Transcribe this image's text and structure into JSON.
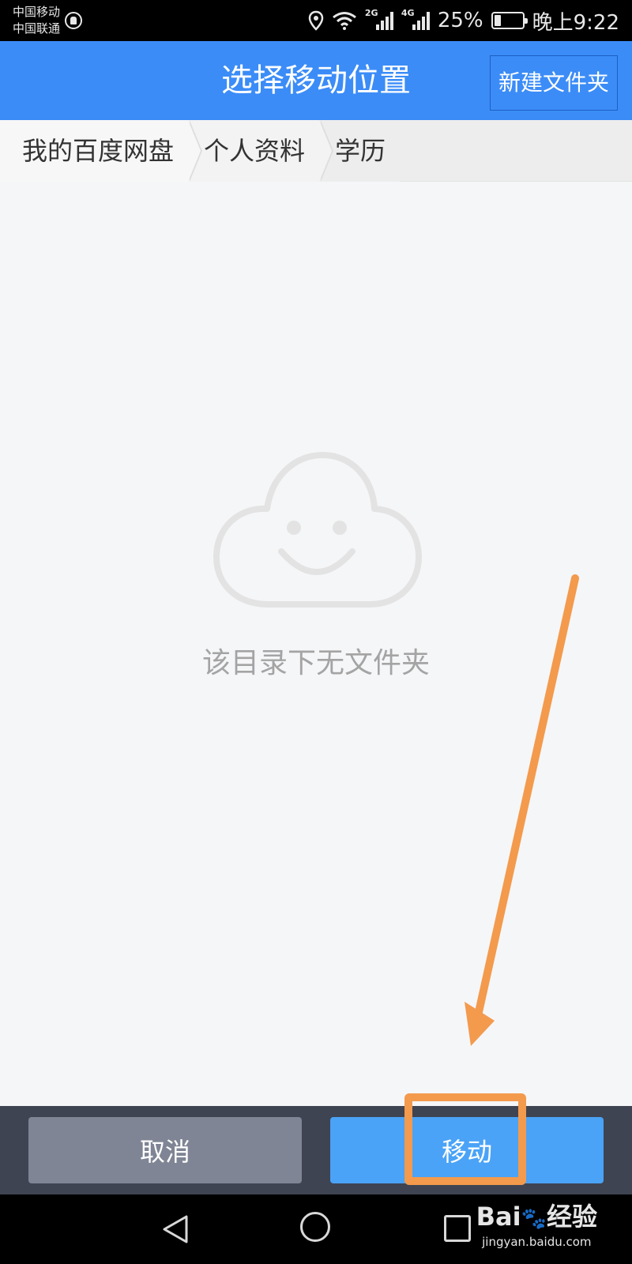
{
  "status_bar": {
    "carrier_1": "中国移动",
    "carrier_2": "中国联通",
    "network_1": "2G",
    "network_2": "4G",
    "battery": "25%",
    "battery_level": 0.25,
    "time": "晚上9:22"
  },
  "header": {
    "title": "选择移动位置",
    "new_folder_label": "新建文件夹"
  },
  "breadcrumb": {
    "items": [
      "我的百度网盘",
      "个人资料",
      "学历"
    ]
  },
  "empty_state": {
    "message": "该目录下无文件夹",
    "icon": "cloud-smile-icon"
  },
  "actions": {
    "cancel_label": "取消",
    "move_label": "移动"
  },
  "watermark": {
    "logo_text": "Bai",
    "logo_suffix": "经验",
    "url": "jingyan.baidu.com"
  },
  "colors": {
    "header_bg": "#3b8cf7",
    "move_button": "#4aa3f7",
    "cancel_button": "#7f8594",
    "annotation": "#f39a4d"
  }
}
